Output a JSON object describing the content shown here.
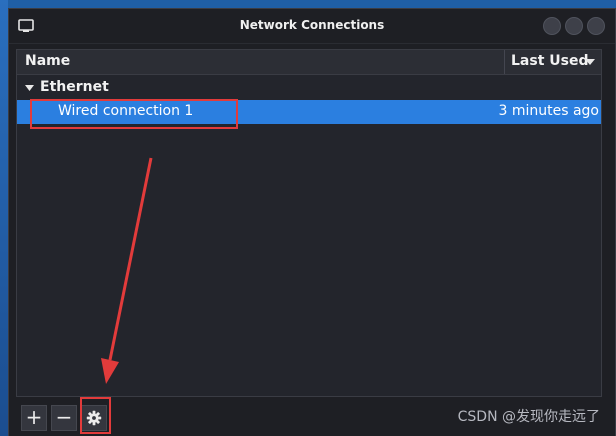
{
  "window": {
    "title": "Network Connections"
  },
  "table": {
    "columns": {
      "name": "Name",
      "last_used": "Last Used"
    },
    "group_label": "Ethernet",
    "rows": [
      {
        "name": "Wired connection 1",
        "last_used": "3 minutes ago",
        "selected": true
      }
    ]
  },
  "toolbar": {
    "add_label": "+",
    "remove_label": "−",
    "settings_icon": "gear-icon"
  },
  "watermark": "CSDN @发现你走远了",
  "colors": {
    "selection": "#2b7fe0",
    "annotation": "#e23b3b",
    "window_bg": "#1e1f24"
  }
}
